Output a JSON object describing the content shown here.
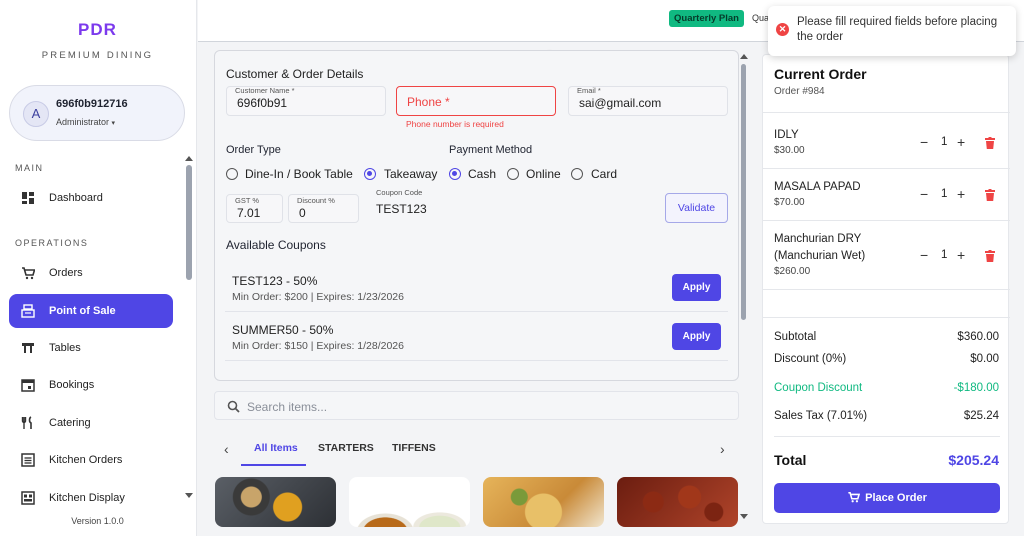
{
  "brand": {
    "name": "PDR",
    "subtitle": "PREMIUM DINING"
  },
  "user": {
    "initial": "A",
    "id": "696f0b912716",
    "role": "Administrator",
    "role_caret": "▾"
  },
  "sidebar": {
    "section_main": "MAIN",
    "section_operations": "OPERATIONS",
    "items": [
      {
        "label": "Dashboard",
        "icon": "dashboard-icon"
      },
      {
        "label": "Orders",
        "icon": "cart-icon"
      },
      {
        "label": "Point of Sale",
        "icon": "pos-icon",
        "active": true
      },
      {
        "label": "Tables",
        "icon": "table-icon"
      },
      {
        "label": "Bookings",
        "icon": "calendar-icon"
      },
      {
        "label": "Catering",
        "icon": "utensils-icon"
      },
      {
        "label": "Kitchen Orders",
        "icon": "list-icon"
      },
      {
        "label": "Kitchen Display",
        "icon": "monitor-icon"
      }
    ],
    "version": "Version 1.0.0"
  },
  "topbar": {
    "plan": "Quarterly Plan",
    "plan_extra": "Qua"
  },
  "toast": {
    "message": "Please fill required fields before placing the order",
    "type": "error"
  },
  "form": {
    "title": "Customer & Order Details",
    "customer_name_label": "Customer Name *",
    "customer_name_value": "696f0b91",
    "phone_placeholder": "Phone *",
    "phone_error": "Phone number is required",
    "email_label": "Email *",
    "email_value": "sai@gmail.com",
    "order_type_label": "Order Type",
    "order_type_options": [
      "Dine-In / Book Table",
      "Takeaway"
    ],
    "order_type_selected": "Takeaway",
    "payment_label": "Payment Method",
    "payment_options": [
      "Cash",
      "Online",
      "Card"
    ],
    "payment_selected": "Cash",
    "gst_label": "GST %",
    "gst_value": "7.01",
    "discount_label": "Discount %",
    "discount_value": "0",
    "coupon_label": "Coupon Code",
    "coupon_value": "TEST123",
    "validate_label": "Validate",
    "coupons_title": "Available Coupons",
    "coupons": [
      {
        "title": "TEST123 - 50%",
        "meta": "Min Order: $200 | Expires: 1/23/2026",
        "action": "Apply"
      },
      {
        "title": "SUMMER50 - 50%",
        "meta": "Min Order: $150 | Expires: 1/28/2026",
        "action": "Apply"
      }
    ]
  },
  "search": {
    "placeholder": "Search items..."
  },
  "tabs": {
    "items": [
      "All Items",
      "STARTERS",
      "TIFFENS"
    ],
    "active": "All Items",
    "prev": "‹",
    "next": "›"
  },
  "order": {
    "title": "Current Order",
    "number": "Order #984",
    "items": [
      {
        "name": "IDLY",
        "price": "$30.00",
        "qty": "1"
      },
      {
        "name": "MASALA PAPAD",
        "price": "$70.00",
        "qty": "1"
      },
      {
        "name": "Manchurian DRY (Manchurian Wet)",
        "price": "$260.00",
        "qty": "1"
      }
    ],
    "minus": "−",
    "plus": "+",
    "subtotal_label": "Subtotal",
    "subtotal": "$360.00",
    "discount_label": "Discount (0%)",
    "discount": "$0.00",
    "coupon_label": "Coupon Discount",
    "coupon": "-$180.00",
    "tax_label": "Sales Tax (7.01%)",
    "tax": "$25.24",
    "total_label": "Total",
    "total": "$205.24",
    "place_label": "Place Order"
  },
  "watermark": {
    "main": "PDR",
    "sub": "PREMIUM DINING"
  },
  "colors": {
    "accent": "#4f46e5",
    "brand": "#7c3aed",
    "success": "#10b981",
    "error": "#ef4444"
  }
}
